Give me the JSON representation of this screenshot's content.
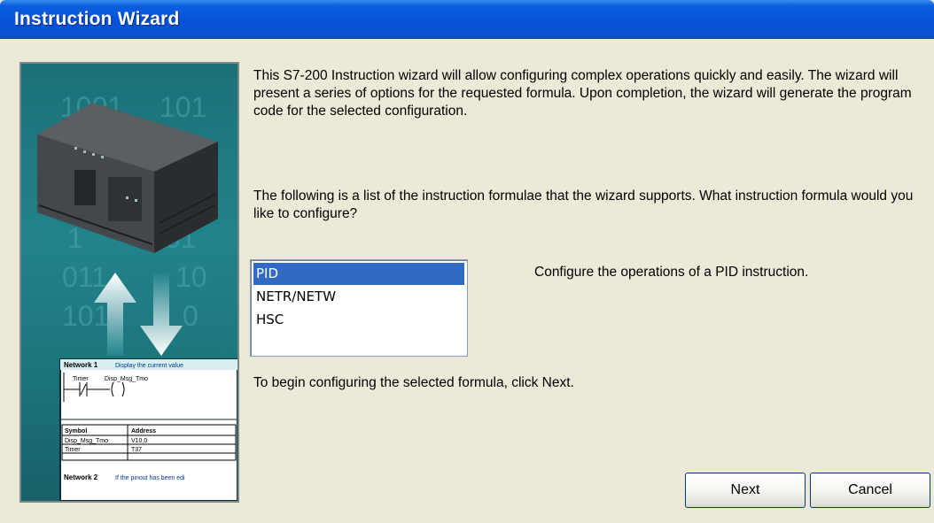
{
  "window": {
    "title": "Instruction Wizard"
  },
  "intro_text": "This S7-200 Instruction wizard will allow configuring complex operations quickly and easily.  The wizard will present a series of options for the requested formula. Upon completion, the wizard will generate the program code for the selected configuration.",
  "question_text": "The following is a list of the instruction formulae that the wizard supports.  What instruction formula would you like to configure?",
  "formula_list": {
    "items": [
      "PID",
      "NETR/NETW",
      "HSC"
    ],
    "selected": "PID"
  },
  "description_text": "Configure the operations of a PID instruction.",
  "hint_text": "To begin configuring the selected formula, click Next.",
  "buttons": {
    "next": "Next",
    "cancel": "Cancel"
  },
  "side_image": {
    "binary_rows": [
      "1001",
      "101",
      "1",
      "01",
      "011",
      "10",
      "1011",
      "0"
    ],
    "ladder": {
      "network1": "Network 1",
      "network1_comment": "Display the current value",
      "contact_label": "Timer",
      "coil_label": "Disp_Msg_Tmo",
      "table_headers": [
        "Symbol",
        "Address"
      ],
      "table_rows": [
        [
          "Disp_Msg_Tmo",
          "V10.0"
        ],
        [
          "Timer",
          "T37"
        ]
      ],
      "network2": "Network 2",
      "network2_comment": "If the pinout has been edi"
    }
  },
  "colors": {
    "titlebar": "#0651d6",
    "selection": "#316ac5",
    "dialog_bg": "#ece9d8",
    "teal": "#22838c"
  }
}
